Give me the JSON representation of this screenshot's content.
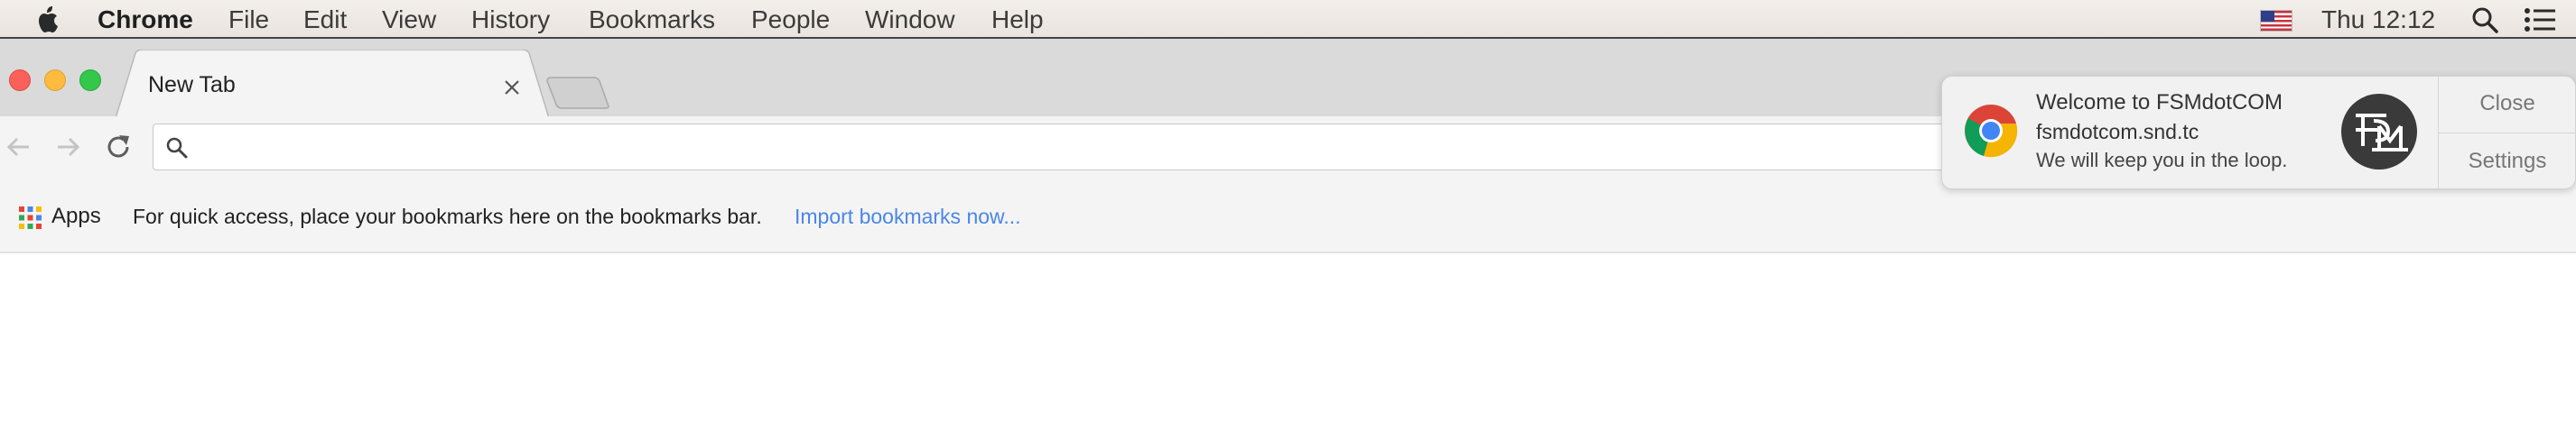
{
  "menubar": {
    "app_name": "Chrome",
    "items": [
      "File",
      "Edit",
      "View",
      "History",
      "Bookmarks",
      "People",
      "Window",
      "Help"
    ],
    "clock": "Thu 12:12",
    "icons": [
      "apple-icon",
      "us-flag-icon",
      "spotlight-search-icon",
      "notification-center-icon"
    ]
  },
  "tabs": [
    {
      "title": "New Tab",
      "active": true
    }
  ],
  "toolbar": {
    "omnibox_value": "",
    "icons": [
      "back-icon",
      "forward-icon",
      "reload-icon",
      "search-icon"
    ]
  },
  "bookmarks_bar": {
    "apps_label": "Apps",
    "hint": "For quick access, place your bookmarks here on the bookmarks bar.",
    "import_link": "Import bookmarks now..."
  },
  "notification": {
    "title": "Welcome to FSMdotCOM",
    "source": "fsmdotcom.snd.tc",
    "message": "We will keep you in the loop.",
    "close_label": "Close",
    "settings_label": "Settings",
    "logo_text": "FSM"
  },
  "colors": {
    "traffic_red": "#fc605b",
    "traffic_yellow": "#fdbc40",
    "traffic_green": "#34c84a",
    "link_blue": "#4a86e8"
  }
}
